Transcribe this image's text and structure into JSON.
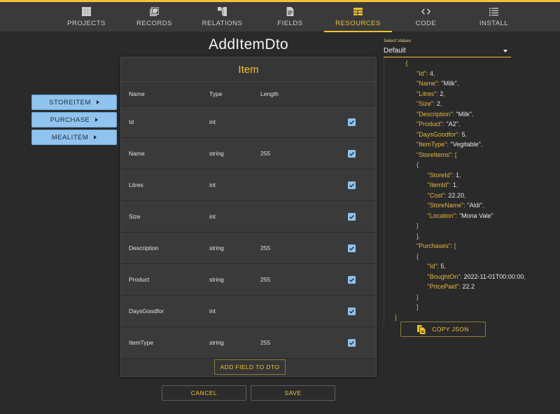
{
  "nav": {
    "items": [
      {
        "label": "PROJECTS",
        "icon": "grid-icon"
      },
      {
        "label": "RECORDS",
        "icon": "library-icon"
      },
      {
        "label": "RELATIONS",
        "icon": "tree-icon"
      },
      {
        "label": "FIELDS",
        "icon": "document-icon"
      },
      {
        "label": "RESOURCES",
        "icon": "table-icon",
        "active": true
      },
      {
        "label": "CODE",
        "icon": "code-icon"
      },
      {
        "label": "INSTALL",
        "icon": "list-icon"
      }
    ]
  },
  "side_buttons": [
    "STOREITEM",
    "PURCHASE",
    "MEALITEM"
  ],
  "dto_title": "AddItemDto",
  "table": {
    "title": "Item",
    "columns": {
      "name": "Name",
      "type": "Type",
      "length": "Length"
    },
    "rows": [
      {
        "name": "Id",
        "type": "int",
        "length": "",
        "checked": true
      },
      {
        "name": "Name",
        "type": "string",
        "length": "255",
        "checked": true
      },
      {
        "name": "Litres",
        "type": "int",
        "length": "",
        "checked": true
      },
      {
        "name": "Size",
        "type": "int",
        "length": "",
        "checked": true
      },
      {
        "name": "Description",
        "type": "string",
        "length": "255",
        "checked": true
      },
      {
        "name": "Product",
        "type": "string",
        "length": "255",
        "checked": true
      },
      {
        "name": "DaysGoodfor",
        "type": "int",
        "length": "",
        "checked": true
      },
      {
        "name": "ItemType",
        "type": "string",
        "length": "255",
        "checked": true
      }
    ],
    "add_field_label": "ADD FIELD TO DTO"
  },
  "actions": {
    "cancel": "CANCEL",
    "save": "SAVE"
  },
  "select_values": {
    "label": "Select Values",
    "value": "Default"
  },
  "json_lines": [
    {
      "indent": 3,
      "parts": [
        [
          "p",
          "{"
        ]
      ]
    },
    {
      "indent": 4,
      "parts": [
        [
          "k",
          "\"Id\""
        ],
        [
          "p",
          ": "
        ],
        [
          "v",
          "4"
        ],
        [
          "p",
          ","
        ]
      ]
    },
    {
      "indent": 4,
      "parts": [
        [
          "k",
          "\"Name\""
        ],
        [
          "p",
          ": "
        ],
        [
          "v",
          "\"Milk\""
        ],
        [
          "p",
          ","
        ]
      ]
    },
    {
      "indent": 4,
      "parts": [
        [
          "k",
          "\"Litres\""
        ],
        [
          "p",
          ": "
        ],
        [
          "v",
          "2"
        ],
        [
          "p",
          ","
        ]
      ]
    },
    {
      "indent": 4,
      "parts": [
        [
          "k",
          "\"Size\""
        ],
        [
          "p",
          ": "
        ],
        [
          "v",
          "2"
        ],
        [
          "p",
          ","
        ]
      ]
    },
    {
      "indent": 4,
      "parts": [
        [
          "k",
          "\"Description\""
        ],
        [
          "p",
          ": "
        ],
        [
          "v",
          "\"Milk\""
        ],
        [
          "p",
          ","
        ]
      ]
    },
    {
      "indent": 4,
      "parts": [
        [
          "k",
          "\"Product\""
        ],
        [
          "p",
          ": "
        ],
        [
          "v",
          "\"A2\""
        ],
        [
          "p",
          ","
        ]
      ]
    },
    {
      "indent": 4,
      "parts": [
        [
          "k",
          "\"DaysGoodfor\""
        ],
        [
          "p",
          ": "
        ],
        [
          "v",
          "5"
        ],
        [
          "p",
          ","
        ]
      ]
    },
    {
      "indent": 4,
      "parts": [
        [
          "k",
          "\"ItemType\""
        ],
        [
          "p",
          ": "
        ],
        [
          "v",
          "\"Vegitable\""
        ],
        [
          "p",
          ","
        ]
      ]
    },
    {
      "indent": 4,
      "parts": [
        [
          "k",
          "\"StoreItems\""
        ],
        [
          "p",
          ": ["
        ]
      ]
    },
    {
      "indent": 4,
      "parts": [
        [
          "p",
          "{"
        ]
      ]
    },
    {
      "indent": 5,
      "parts": [
        [
          "k",
          "\"StoreId\""
        ],
        [
          "p",
          ": "
        ],
        [
          "v",
          "1"
        ],
        [
          "p",
          ","
        ]
      ]
    },
    {
      "indent": 5,
      "parts": [
        [
          "k",
          "\"ItemId\""
        ],
        [
          "p",
          ": "
        ],
        [
          "v",
          "1"
        ],
        [
          "p",
          ","
        ]
      ]
    },
    {
      "indent": 5,
      "parts": [
        [
          "k",
          "\"Cost\""
        ],
        [
          "p",
          ": "
        ],
        [
          "v",
          "22.20"
        ],
        [
          "p",
          ","
        ]
      ]
    },
    {
      "indent": 5,
      "parts": [
        [
          "k",
          "\"StoreName\""
        ],
        [
          "p",
          ": "
        ],
        [
          "v",
          "\"Aldi\""
        ],
        [
          "p",
          ","
        ]
      ]
    },
    {
      "indent": 5,
      "parts": [
        [
          "k",
          "\"Location\""
        ],
        [
          "p",
          ": "
        ],
        [
          "v",
          "\"Mona Vale\""
        ]
      ]
    },
    {
      "indent": 4,
      "parts": [
        [
          "p",
          "}"
        ]
      ]
    },
    {
      "indent": 4,
      "parts": [
        [
          "p",
          "],"
        ]
      ]
    },
    {
      "indent": 4,
      "parts": [
        [
          "k",
          "\"Purchases\""
        ],
        [
          "p",
          ": ["
        ]
      ]
    },
    {
      "indent": 4,
      "parts": [
        [
          "p",
          "{"
        ]
      ]
    },
    {
      "indent": 5,
      "parts": [
        [
          "k",
          "\"Id\""
        ],
        [
          "p",
          ": "
        ],
        [
          "v",
          "5"
        ],
        [
          "p",
          ","
        ]
      ]
    },
    {
      "indent": 5,
      "parts": [
        [
          "k",
          "\"BoughtOn\""
        ],
        [
          "p",
          ": "
        ],
        [
          "v",
          "2022-11-01T00:00:00"
        ],
        [
          "p",
          ","
        ]
      ]
    },
    {
      "indent": 5,
      "parts": [
        [
          "k",
          "\"PricePaid\""
        ],
        [
          "p",
          ": "
        ],
        [
          "v",
          "22.2"
        ]
      ]
    },
    {
      "indent": 4,
      "parts": [
        [
          "p",
          "}"
        ]
      ]
    },
    {
      "indent": 4,
      "parts": [
        [
          "p",
          "]"
        ]
      ]
    },
    {
      "indent": 2,
      "parts": [
        [
          "p",
          "}"
        ]
      ]
    }
  ],
  "copy_json_label": "COPY JSON",
  "colors": {
    "accent": "#f1c232",
    "side_button": "#90c4ee",
    "background": "#2a2a2b"
  }
}
